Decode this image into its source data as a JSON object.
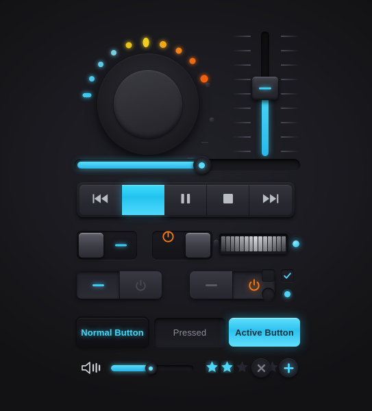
{
  "theme": {
    "background": "#141418",
    "panel": "#23232a",
    "accent_cyan": "#3ecbf0",
    "accent_orange": "#f07a16",
    "text_dim": "#8c8c96"
  },
  "knob": {
    "name": "rotary-knob",
    "value_dots": [
      {
        "color": "#3ecbf0",
        "angle": -172,
        "size": 9
      },
      {
        "color": "#4ac9ec",
        "angle": -156,
        "size": 8
      },
      {
        "color": "#5ec9e6",
        "angle": -140,
        "size": 8
      },
      {
        "color": "#79cfe0",
        "angle": -124,
        "size": 8
      },
      {
        "color": "#e8c21f",
        "angle": -108,
        "size": 9
      },
      {
        "color": "#f0cf22",
        "angle": -92,
        "size": 9
      },
      {
        "color": "#f2a81c",
        "angle": -76,
        "size": 10
      },
      {
        "color": "#f0821a",
        "angle": -60,
        "size": 9
      },
      {
        "color": "#ee6c18",
        "angle": -44,
        "size": 9
      },
      {
        "color": "#f05f12",
        "angle": -24,
        "size": 11
      }
    ],
    "pins": [
      {
        "angle": -18,
        "radius": 92
      },
      {
        "angle": 14,
        "radius": 96
      }
    ],
    "ticks": [
      {
        "angle": 34,
        "radius": 100
      },
      {
        "angle": 52,
        "radius": 100
      }
    ]
  },
  "vertical_slider": {
    "name": "vertical-fader",
    "value_percent": 55,
    "tick_count": 9,
    "handle_label": "fader-handle"
  },
  "horizontal_slider": {
    "name": "horizontal-progress-slider",
    "value_percent": 58
  },
  "transport": {
    "name": "transport-bar",
    "buttons": [
      {
        "id": "rewind",
        "icon": "rewind-icon",
        "label": "Rewind",
        "active": false
      },
      {
        "id": "play",
        "icon": "play-icon",
        "label": "Play",
        "active": true
      },
      {
        "id": "pause",
        "icon": "pause-icon",
        "label": "Pause",
        "active": false
      },
      {
        "id": "stop",
        "icon": "stop-icon",
        "label": "Stop",
        "active": false
      },
      {
        "id": "forward",
        "icon": "fast-forward-icon",
        "label": "Fast Forward",
        "active": false
      }
    ]
  },
  "rockers": [
    {
      "name": "rocker-switch-left",
      "handle_side": "left",
      "indicator": "dash",
      "indicator_color": "#3ecbf0",
      "state": "on"
    },
    {
      "name": "rocker-switch-right",
      "handle_side": "right",
      "indicator": "power",
      "indicator_color": "#f07a16",
      "state": "off"
    }
  ],
  "meter": {
    "name": "led-level-meter",
    "segments": 14,
    "peak_index": 7,
    "led_color": "#3ecbf0"
  },
  "pairs": [
    {
      "name": "button-pair-left",
      "halves": [
        {
          "icon": "dash-icon",
          "state": "active",
          "color": "#3ecbf0"
        },
        {
          "icon": "power-icon",
          "state": "inactive",
          "color": "#3c3c44"
        }
      ]
    },
    {
      "name": "button-pair-right",
      "halves": [
        {
          "icon": "dash-icon",
          "state": "inactive",
          "color": "#5a5a64"
        },
        {
          "icon": "power-icon",
          "state": "active",
          "color": "#f07a16"
        }
      ]
    }
  ],
  "choices": {
    "checkbox_unchecked": {
      "name": "checkbox-unchecked",
      "checked": false
    },
    "checkbox_checked": {
      "name": "checkbox-checked",
      "checked": true,
      "glyph": "check-icon"
    },
    "radio_unselected": {
      "name": "radio-unselected",
      "selected": false
    },
    "radio_selected": {
      "name": "radio-selected",
      "selected": true
    }
  },
  "buttons": {
    "normal": {
      "label": "Normal Button",
      "state": "normal"
    },
    "pressed": {
      "label": "Pressed",
      "state": "pressed"
    },
    "active": {
      "label": "Active Button",
      "state": "active"
    }
  },
  "bottom": {
    "speaker_icon": "speaker-volume-icon",
    "volume": {
      "name": "volume-slider",
      "value_percent": 48
    },
    "rating": {
      "name": "star-rating",
      "value": 2,
      "max": 5
    },
    "close_button": {
      "name": "close-button",
      "glyph": "x-icon"
    },
    "add_button": {
      "name": "add-button",
      "glyph": "plus-icon"
    }
  }
}
